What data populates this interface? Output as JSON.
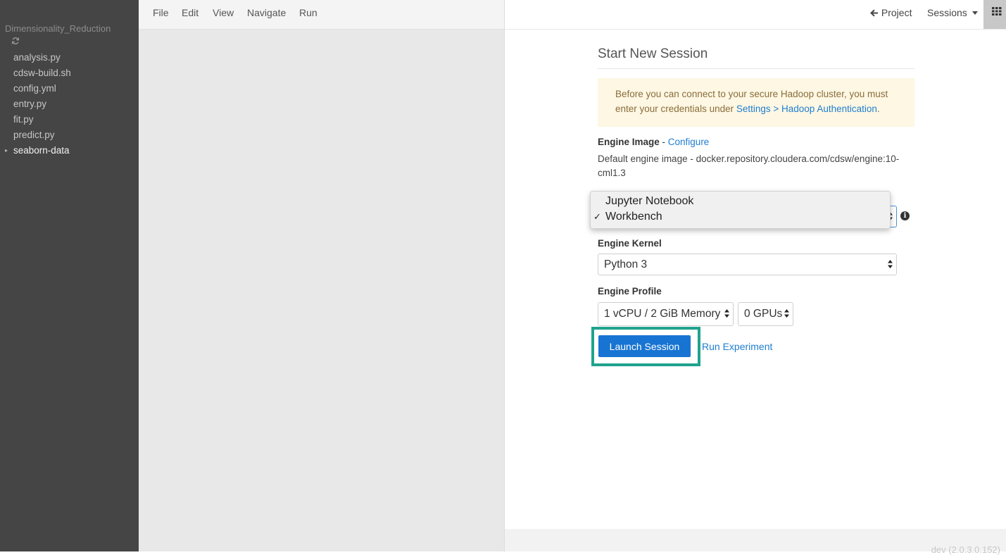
{
  "sidebar": {
    "project_name": "Dimensionality_Reduction",
    "refresh_icon": "refresh-icon",
    "files": [
      "analysis.py",
      "cdsw-build.sh",
      "config.yml",
      "entry.py",
      "fit.py",
      "predict.py"
    ],
    "folder": {
      "label": "seaborn-data",
      "caret": "▸"
    }
  },
  "menubar": {
    "items": [
      "File",
      "Edit",
      "View",
      "Navigate",
      "Run"
    ]
  },
  "topbar": {
    "back_arrow": "🡐",
    "project_label": "Project",
    "sessions_label": "Sessions",
    "grid_icon": "grid-icon"
  },
  "session_form": {
    "title": "Start New Session",
    "alert": {
      "text": "Before you can connect to your secure Hadoop cluster, you must enter your credentials under ",
      "link": "Settings > Hadoop Authentication",
      "suffix": "."
    },
    "engine_image": {
      "label": "Engine Image",
      "separator": " - ",
      "configure_link": "Configure",
      "description": "Default engine image - docker.repository.cloudera.com/cdsw/engine:10-cml1.3"
    },
    "editor_dropdown": {
      "options": [
        "Jupyter Notebook",
        "Workbench"
      ],
      "selected": "Workbench",
      "checkmark": "✓"
    },
    "info_icon": "i",
    "engine_kernel": {
      "label": "Engine Kernel",
      "value": "Python 3"
    },
    "engine_profile": {
      "label": "Engine Profile",
      "cpu_memory": "1 vCPU / 2 GiB Memory",
      "gpus": "0 GPUs"
    },
    "launch_button": "Launch Session",
    "run_experiment_link": "Run Experiment"
  },
  "footer": {
    "version": "dev (2.0.3.0.152)"
  },
  "colors": {
    "sidebar_bg": "#454545",
    "accent_blue": "#1874d2",
    "highlight_green": "#20a38d",
    "alert_bg": "#fdf7e3"
  }
}
